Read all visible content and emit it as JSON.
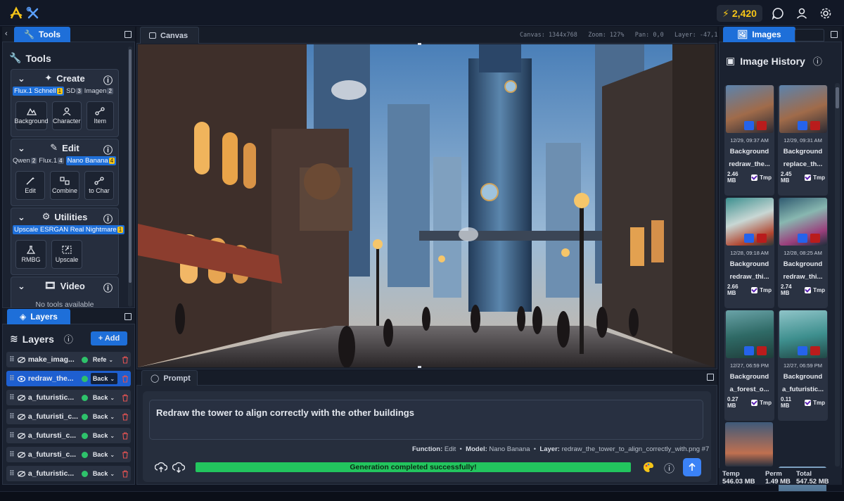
{
  "header": {
    "credits": "2,420",
    "icons": [
      "logo-icon",
      "tools-icon",
      "lightning-icon",
      "chat-icon",
      "user-icon",
      "settings-icon"
    ]
  },
  "tools_panel": {
    "tab_label": "Tools",
    "title": "Tools",
    "sections": [
      {
        "title": "Create",
        "models": [
          {
            "name": "Flux.1 Schnell",
            "count": "1",
            "selected": true
          },
          {
            "name": "SD",
            "count": "3",
            "selected": false
          },
          {
            "name": "Imagen",
            "count": "2",
            "selected": false
          }
        ],
        "buttons": [
          "Background",
          "Character",
          "Item"
        ]
      },
      {
        "title": "Edit",
        "models": [
          {
            "name": "Qwen",
            "count": "2",
            "selected": false
          },
          {
            "name": "Flux.1",
            "count": "4",
            "selected": false
          },
          {
            "name": "Nano Banana",
            "count": "4",
            "selected": true
          }
        ],
        "buttons": [
          "Edit",
          "Combine",
          "to Char"
        ]
      },
      {
        "title": "Utilities",
        "models": [
          {
            "name": "Upscale ESRGAN Real Nightmare",
            "count": "1",
            "selected": true
          }
        ],
        "buttons": [
          "RMBG",
          "Upscale"
        ]
      },
      {
        "title": "Video",
        "empty_text": "No tools available"
      }
    ]
  },
  "layers_panel": {
    "tab_label": "Layers",
    "title": "Layers",
    "add_label": "+ Add",
    "rows": [
      {
        "name": "make_imag...",
        "blend": "Refe",
        "selected": false
      },
      {
        "name": "redraw_the...",
        "blend": "Back",
        "selected": true
      },
      {
        "name": "a_futuristic...",
        "blend": "Back",
        "selected": false
      },
      {
        "name": "a_futuristi_c...",
        "blend": "Back",
        "selected": false
      },
      {
        "name": "a_futursti_c...",
        "blend": "Back",
        "selected": false
      },
      {
        "name": "a_futursti_c...",
        "blend": "Back",
        "selected": false
      },
      {
        "name": "a_futuristic...",
        "blend": "Back",
        "selected": false
      }
    ]
  },
  "canvas": {
    "tab_label": "Canvas",
    "info": "Canvas: 1344x768   Zoom: 127%   Pan: 0,0   Layer: -47,1"
  },
  "prompt": {
    "tab_label": "Prompt",
    "text": "Redraw the tower to align correctly with the other buildings",
    "function_label": "Function:",
    "function_value": "Edit",
    "model_label": "Model:",
    "model_value": "Nano Banana",
    "layer_label": "Layer:",
    "layer_value": "redraw_the_tower_to_align_correctly_with.png #7",
    "status": "Generation completed successfully!"
  },
  "images_panel": {
    "tab_label": "Images",
    "title": "Image History",
    "cards": [
      {
        "date": "12/29, 09:37 AM",
        "type": "Background",
        "file": "redraw_the...",
        "size": "2.46 MB",
        "tmp": "Tmp",
        "palette": "city"
      },
      {
        "date": "12/29, 09:31 AM",
        "type": "Background",
        "file": "replace_th...",
        "size": "2.45 MB",
        "tmp": "Tmp",
        "palette": "city"
      },
      {
        "date": "12/28, 09:18 AM",
        "type": "Background",
        "file": "redraw_thi...",
        "size": "2.66 MB",
        "tmp": "Tmp",
        "palette": "reef"
      },
      {
        "date": "12/28, 08:25 AM",
        "type": "Background",
        "file": "redraw_thi...",
        "size": "2.74 MB",
        "tmp": "Tmp",
        "palette": "reef2"
      },
      {
        "date": "12/27, 06:59 PM",
        "type": "Background",
        "file": "a_forest_o...",
        "size": "0.27 MB",
        "tmp": "Tmp",
        "palette": "forest"
      },
      {
        "date": "12/27, 06:59 PM",
        "type": "Background",
        "file": "a_futuristic...",
        "size": "0.11 MB",
        "tmp": "Tmp",
        "palette": "teal"
      }
    ],
    "storage": {
      "temp_label": "Temp",
      "temp_value": "546.03 MB",
      "perm_label": "Perm",
      "perm_value": "1.49 MB",
      "total_label": "Total",
      "total_value": "547.52 MB"
    }
  }
}
